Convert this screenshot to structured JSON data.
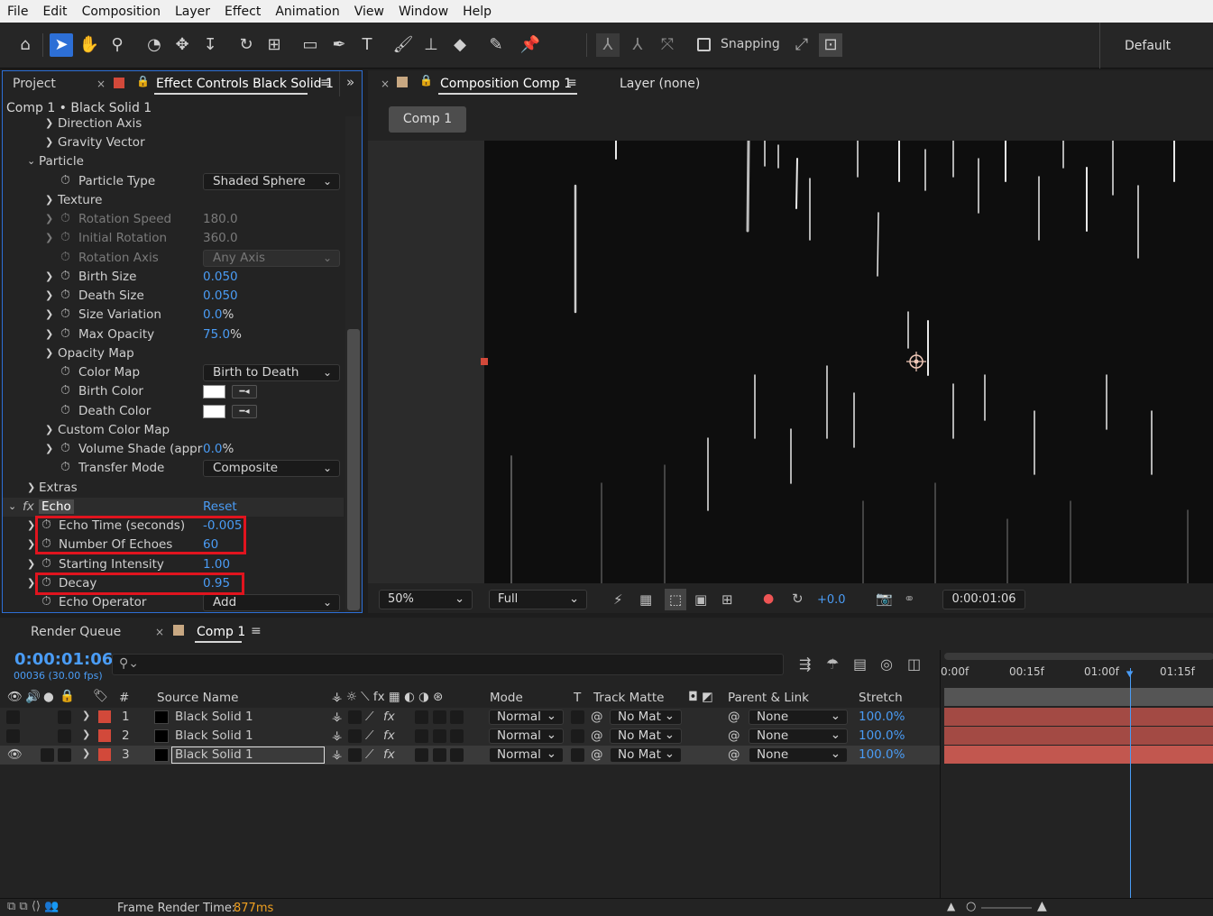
{
  "menu": [
    "File",
    "Edit",
    "Composition",
    "Layer",
    "Effect",
    "Animation",
    "View",
    "Window",
    "Help"
  ],
  "toolbar": {
    "snapping_label": "Snapping",
    "workspace_label": "Default"
  },
  "left_panel": {
    "tab_project": "Project",
    "tab_effect_controls": "Effect Controls Black Solid 1",
    "breadcrumb": "Comp 1 • Black Solid 1",
    "rows": [
      {
        "label": "Direction Axis"
      },
      {
        "label": "Gravity Vector"
      },
      {
        "label": "Particle"
      },
      {
        "label": "Particle Type",
        "value": "Shaded Sphere"
      },
      {
        "label": "Texture"
      },
      {
        "label": "Rotation Speed",
        "value": "180.0"
      },
      {
        "label": "Initial Rotation",
        "value": "360.0"
      },
      {
        "label": "Rotation Axis",
        "value": "Any Axis"
      },
      {
        "label": "Birth Size",
        "value": "0.050"
      },
      {
        "label": "Death Size",
        "value": "0.050"
      },
      {
        "label": "Size Variation",
        "value": "0.0",
        "unit": "%"
      },
      {
        "label": "Max Opacity",
        "value": "75.0",
        "unit": "%"
      },
      {
        "label": "Opacity Map"
      },
      {
        "label": "Color Map",
        "value": "Birth to Death"
      },
      {
        "label": "Birth Color"
      },
      {
        "label": "Death Color"
      },
      {
        "label": "Custom Color Map"
      },
      {
        "label": "Volume Shade (appr",
        "value": "0.0",
        "unit": "%"
      },
      {
        "label": "Transfer Mode",
        "value": "Composite"
      },
      {
        "label": "Extras"
      },
      {
        "label": "Echo",
        "value": "Reset"
      },
      {
        "label": "Echo Time (seconds)",
        "value": "-0.005"
      },
      {
        "label": "Number Of Echoes",
        "value": "60"
      },
      {
        "label": "Starting Intensity",
        "value": "1.00"
      },
      {
        "label": "Decay",
        "value": "0.95"
      },
      {
        "label": "Echo Operator",
        "value": "Add"
      }
    ]
  },
  "viewer": {
    "tab_composition": "Composition Comp 1",
    "tab_layer": "Layer (none)",
    "comp_button": "Comp 1",
    "zoom": "50%",
    "resolution": "Full",
    "exposure": "+0.0",
    "timecode": "0:00:01:06"
  },
  "timeline": {
    "tab_render_queue": "Render Queue",
    "tab_comp": "Comp 1",
    "current_time": "0:00:01:06",
    "frame_info": "00036 (30.00 fps)",
    "search_placeholder": "",
    "columns": {
      "num": "#",
      "source": "Source Name",
      "mode": "Mode",
      "t": "T",
      "matte": "Track Matte",
      "parent": "Parent & Link",
      "stretch": "Stretch"
    },
    "ruler": [
      "0:00f",
      "00:15f",
      "01:00f",
      "01:15f"
    ],
    "layers": [
      {
        "num": "1",
        "name": "Black Solid 1",
        "mode": "Normal",
        "matte": "No Mat",
        "parent": "None",
        "stretch": "100.0%"
      },
      {
        "num": "2",
        "name": "Black Solid 1",
        "mode": "Normal",
        "matte": "No Mat",
        "parent": "None",
        "stretch": "100.0%"
      },
      {
        "num": "3",
        "name": "Black Solid 1",
        "mode": "Normal",
        "matte": "No Mat",
        "parent": "None",
        "stretch": "100.0%"
      }
    ],
    "footer_label": "Frame Render Time:",
    "footer_value": "877ms"
  },
  "colors": {
    "accent": "#2d6fd6",
    "value_blue": "#4a9cf5",
    "label_red": "#d2493a",
    "highlight": "#e0141e"
  }
}
